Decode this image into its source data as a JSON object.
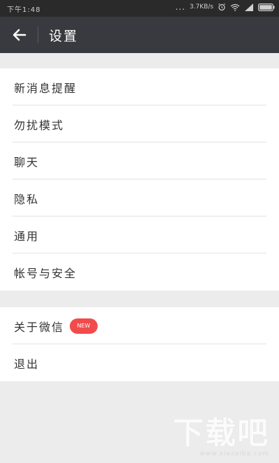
{
  "status_bar": {
    "time": "下午1:48",
    "speed": "3.7KB/s",
    "dots": "...",
    "icons": [
      "alarm-icon",
      "wifi-icon",
      "signal-icon",
      "battery-icon"
    ]
  },
  "app_bar": {
    "title": "设置",
    "back_icon": "arrow-left-icon"
  },
  "settings_group_1": {
    "items": [
      {
        "label": "新消息提醒"
      },
      {
        "label": "勿扰模式"
      },
      {
        "label": "聊天"
      },
      {
        "label": "隐私"
      },
      {
        "label": "通用"
      },
      {
        "label": "帐号与安全"
      }
    ]
  },
  "settings_group_2": {
    "items": [
      {
        "label": "关于微信",
        "badge": "NEW"
      },
      {
        "label": "退出"
      }
    ]
  },
  "watermark": {
    "text": "下载吧",
    "url": "www.xiazaiba.com"
  },
  "colors": {
    "app_bar_bg": "#393a3f",
    "status_bar_bg": "#2a2a2a",
    "page_bg": "#ececec",
    "badge_bg": "#f24b4b"
  }
}
